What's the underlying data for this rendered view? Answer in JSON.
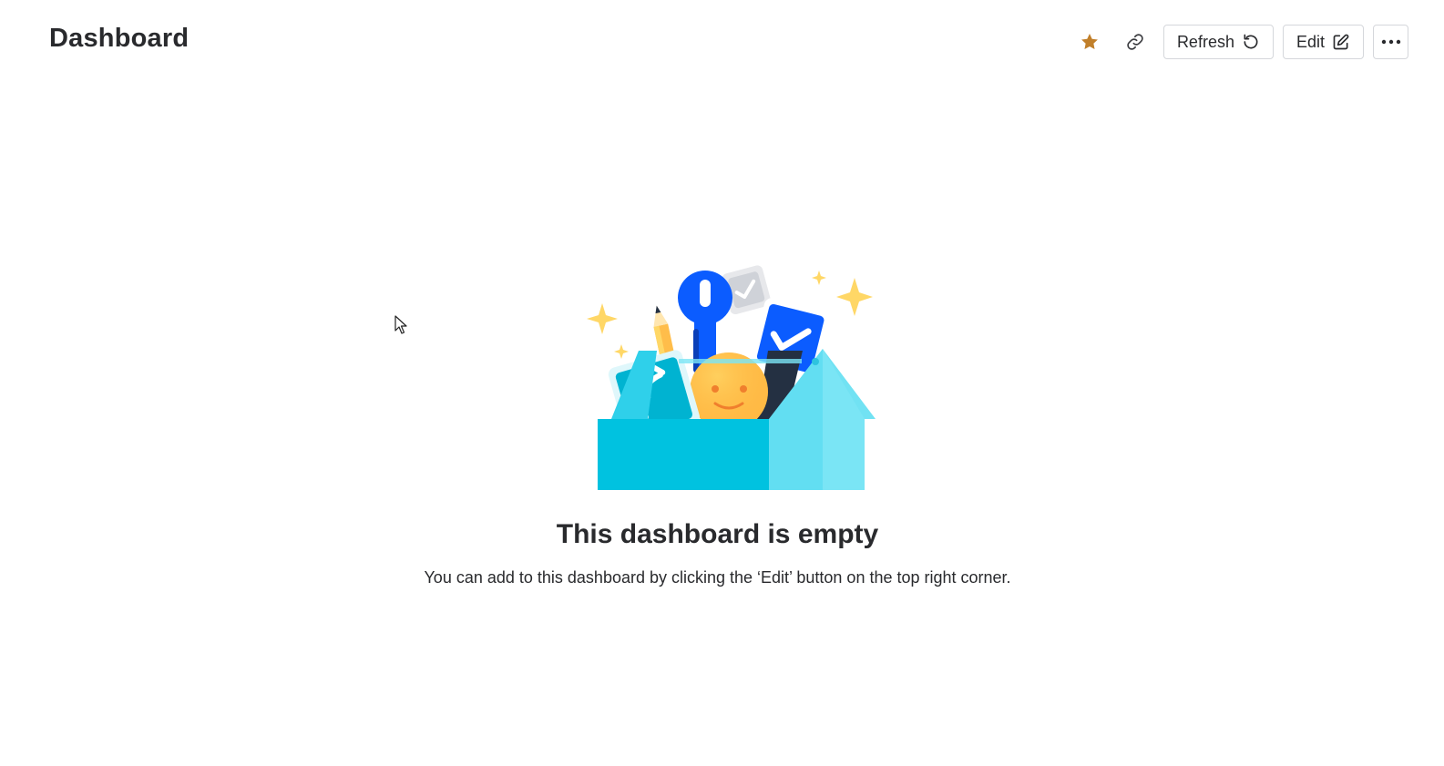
{
  "header": {
    "title": "Dashboard"
  },
  "toolbar": {
    "favorite_icon": "star-icon",
    "favorite_color": "#c17f2a",
    "link_icon": "link-icon",
    "refresh_label": "Refresh",
    "refresh_icon": "refresh-icon",
    "edit_label": "Edit",
    "edit_icon": "edit-icon",
    "more_icon": "more-horizontal-icon"
  },
  "empty_state": {
    "illustration": "toolbox-illustration",
    "title": "This dashboard is empty",
    "description": "You can add to this dashboard by clicking the ‘Edit’ button on the top right corner."
  },
  "colors": {
    "text": "#292a2d",
    "border": "#d5d7db",
    "toolbox": "#00c2e0",
    "accent_blue": "#0b5cff",
    "sparkle": "#ffd766"
  }
}
